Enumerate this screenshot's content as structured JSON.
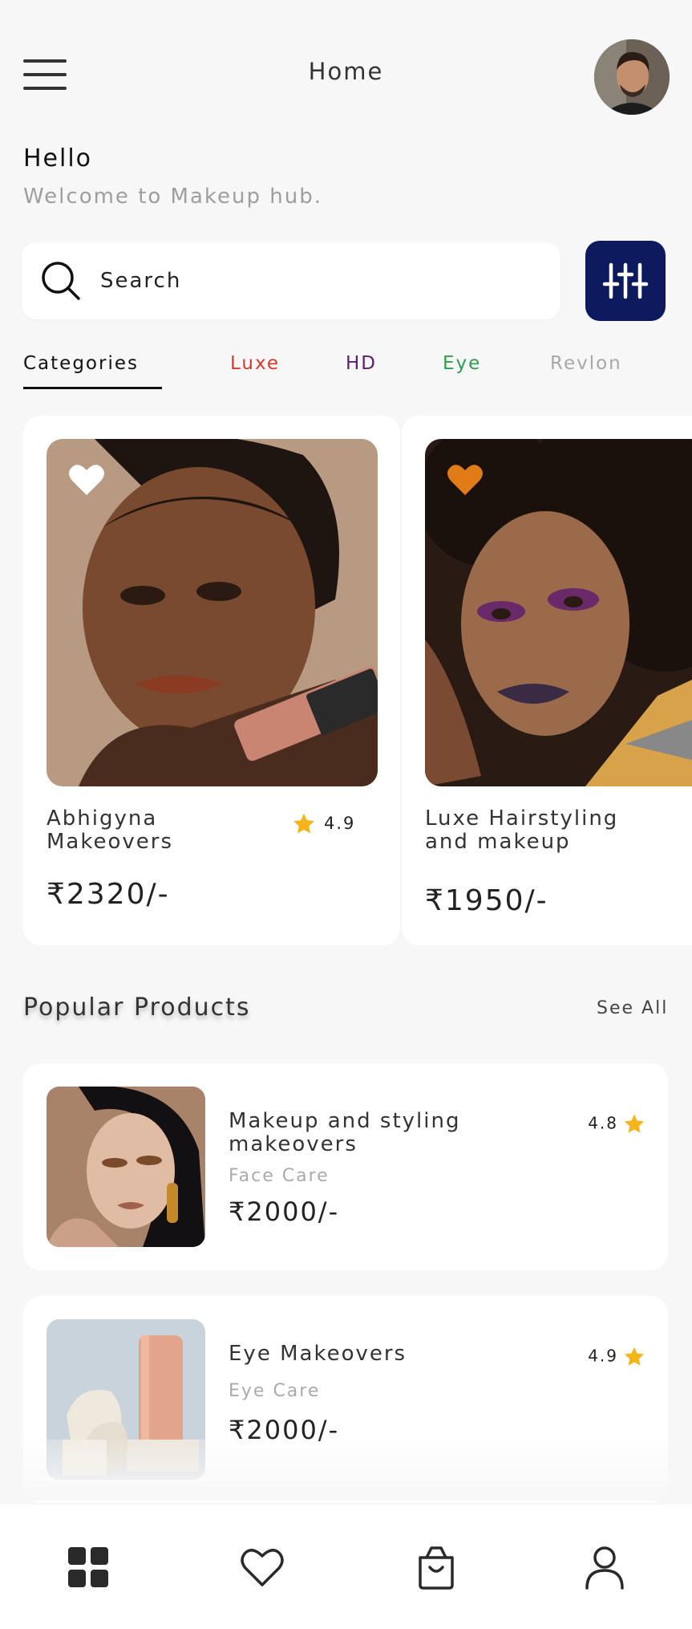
{
  "header": {
    "title": "Home"
  },
  "greeting": {
    "title": "Hello",
    "subtitle": "Welcome to Makeup hub."
  },
  "search": {
    "placeholder": "Search"
  },
  "tabs": [
    {
      "label": "Categories",
      "color": "#111111",
      "active": true
    },
    {
      "label": "Luxe",
      "color": "#d9382c"
    },
    {
      "label": "HD",
      "color": "#5c1f6e"
    },
    {
      "label": "Eye",
      "color": "#2e9e48"
    },
    {
      "label": "Revlon",
      "color": "#a8a8a8"
    }
  ],
  "featured": [
    {
      "name": "Abhigyna Makeovers",
      "rating": "4.9",
      "price": "₹2320/-",
      "heart_color": "#ffffff"
    },
    {
      "name": "Luxe Hairstyling and makeup",
      "price": "₹1950/-",
      "heart_color": "#e07b17"
    }
  ],
  "popular": {
    "title": "Popular Products",
    "see_all": "See All",
    "items": [
      {
        "name": "Makeup and styling makeovers",
        "category": "Face Care",
        "price": "₹2000/-",
        "rating": "4.8"
      },
      {
        "name": "Eye Makeovers",
        "category": "Eye Care",
        "price": "₹2000/-",
        "rating": "4.9"
      }
    ]
  },
  "bottom_nav": [
    "home-grid-icon",
    "heart-icon",
    "shopping-bag-icon",
    "profile-icon"
  ],
  "colors": {
    "accent": "#0d1b5e",
    "star": "#f4b41a"
  }
}
